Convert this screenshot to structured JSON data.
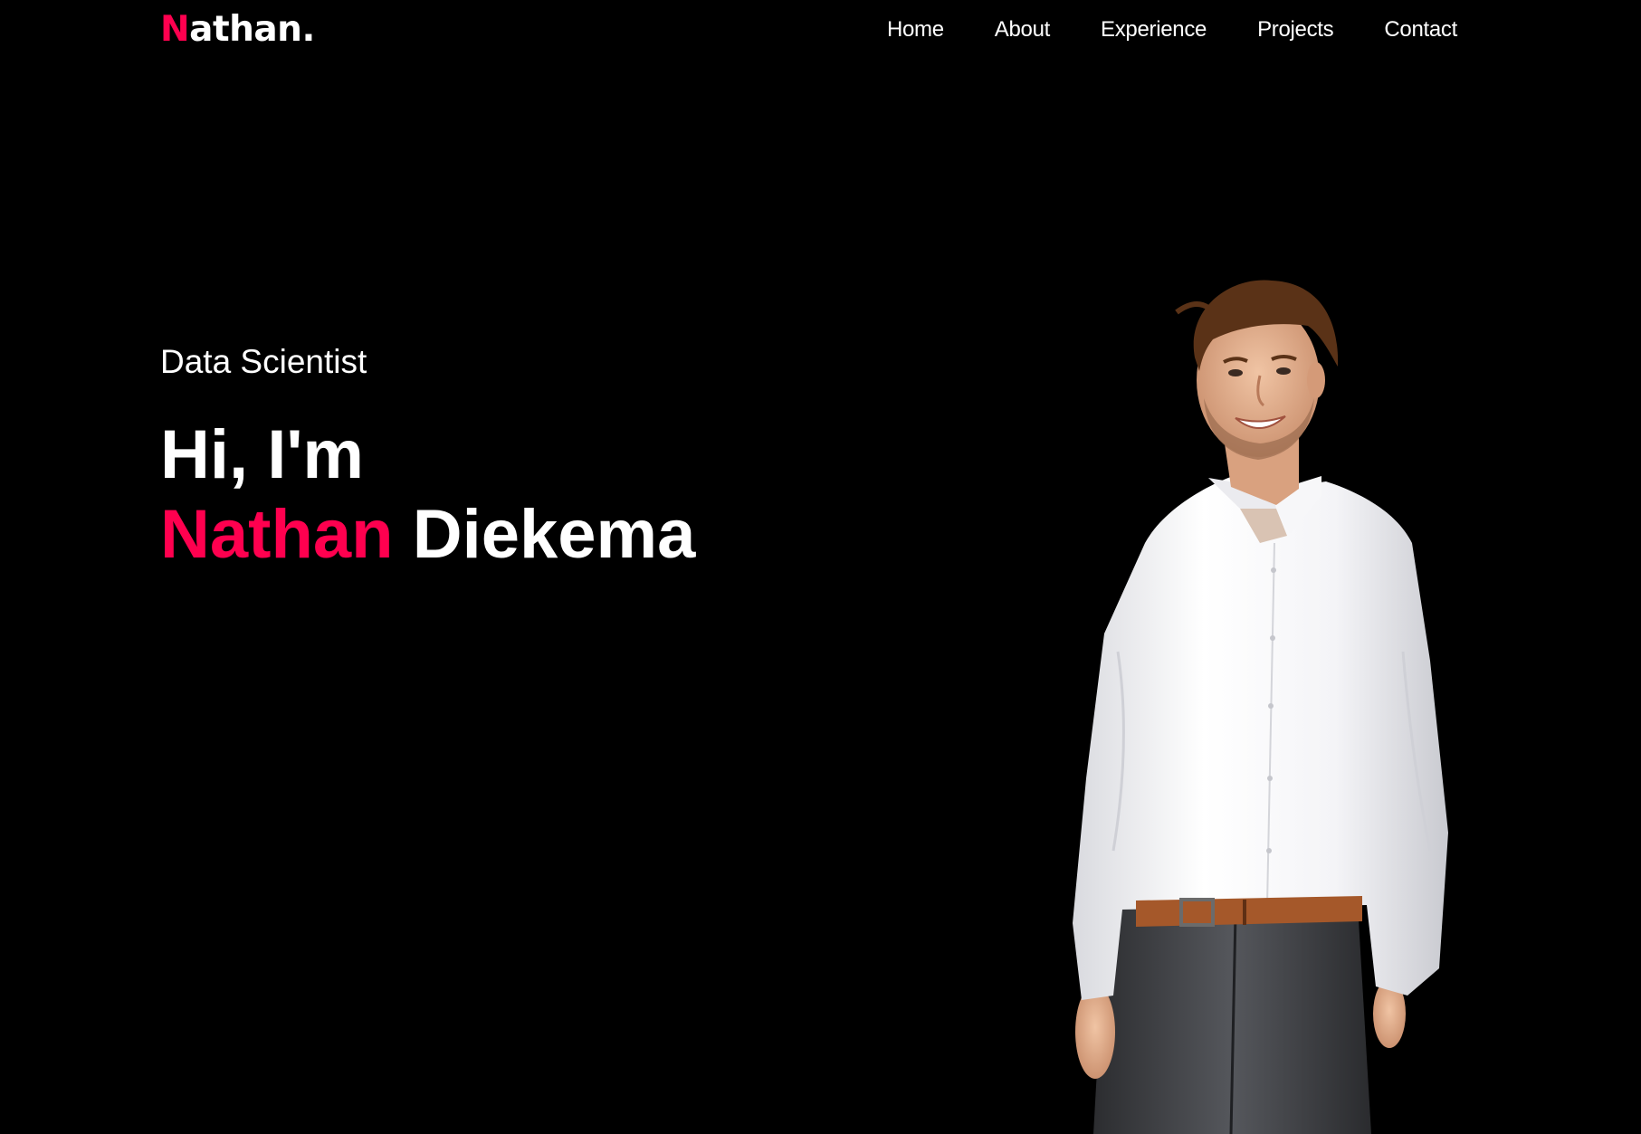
{
  "header": {
    "logo_first_letter": "N",
    "logo_rest": "athan.",
    "nav": [
      {
        "label": "Home"
      },
      {
        "label": "About"
      },
      {
        "label": "Experience"
      },
      {
        "label": "Projects"
      },
      {
        "label": "Contact"
      }
    ]
  },
  "hero": {
    "subtitle": "Data Scientist",
    "greeting": "Hi, I'm",
    "first_name": "Nathan",
    "last_name": "Diekema"
  },
  "colors": {
    "background": "#000000",
    "accent": "#ff004f",
    "text": "#ffffff"
  }
}
